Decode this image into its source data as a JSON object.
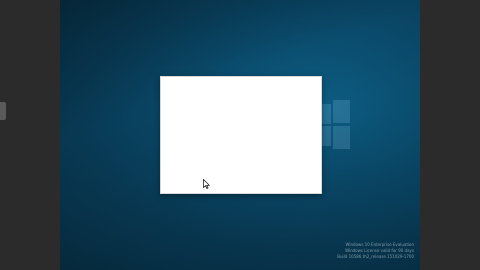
{
  "desktop": {
    "watermark_line1": "Windows 10 Enterprise Evaluation",
    "watermark_line2": "Windows License valid for 90 days",
    "watermark_line3": "Build 10586.th2_release.151029-1700"
  },
  "colors": {
    "desktop_bg": "#0a4a6b",
    "side_bars": "#2b2b2b",
    "dialog_bg": "#ffffff"
  },
  "icons": {
    "logo": "windows-logo-icon",
    "pointer": "mouse-cursor-icon",
    "handle": "side-handle-icon"
  }
}
